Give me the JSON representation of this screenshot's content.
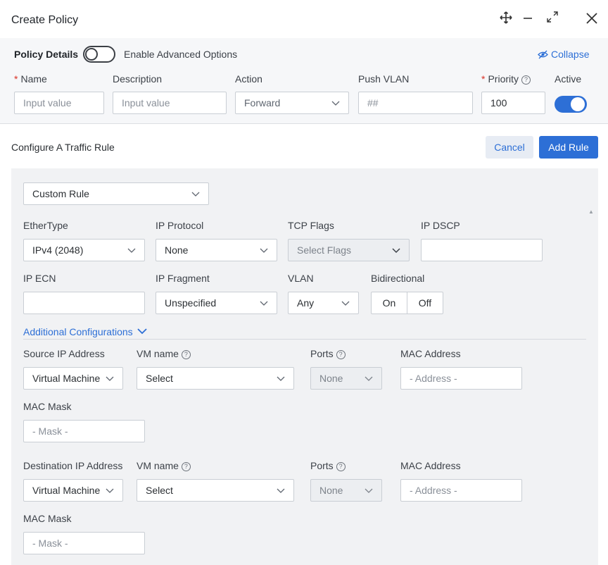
{
  "dialog": {
    "title": "Create Policy"
  },
  "header_icons": {
    "move": "move-icon",
    "minimize": "minimize-icon",
    "expand": "expand-icon",
    "close": "close-icon"
  },
  "policy": {
    "section_label": "Policy Details",
    "advanced_label": "Enable Advanced Options",
    "advanced_on": false,
    "collapse_label": "Collapse",
    "name_label": "Name",
    "name_placeholder": "Input value",
    "description_label": "Description",
    "description_placeholder": "Input value",
    "action_label": "Action",
    "action_value": "Forward",
    "push_vlan_label": "Push VLAN",
    "push_vlan_placeholder": "##",
    "priority_label": "Priority",
    "priority_value": "100",
    "active_label": "Active",
    "active_on": true
  },
  "rule": {
    "title": "Configure A Traffic Rule",
    "cancel_label": "Cancel",
    "add_label": "Add Rule",
    "rule_type": "Custom Rule",
    "ethertype_label": "EtherType",
    "ethertype_value": "IPv4 (2048)",
    "ip_protocol_label": "IP Protocol",
    "ip_protocol_value": "None",
    "tcp_flags_label": "TCP Flags",
    "tcp_flags_value": "Select Flags",
    "ip_dscp_label": "IP DSCP",
    "ip_ecn_label": "IP ECN",
    "ip_fragment_label": "IP Fragment",
    "ip_fragment_value": "Unspecified",
    "vlan_label": "VLAN",
    "vlan_value": "Any",
    "bidirectional_label": "Bidirectional",
    "bidirectional_on": "On",
    "bidirectional_off": "Off",
    "additional_label": "Additional Configurations",
    "source": {
      "ip_label": "Source IP Address",
      "ip_value": "Virtual Machine",
      "vm_label": "VM name",
      "vm_value": "Select",
      "ports_label": "Ports",
      "ports_value": "None",
      "mac_label": "MAC Address",
      "mac_placeholder": "- Address -",
      "mask_label": "MAC Mask",
      "mask_placeholder": "- Mask -"
    },
    "destination": {
      "ip_label": "Destination IP Address",
      "ip_value": "Virtual Machine",
      "vm_label": "VM name",
      "vm_value": "Select",
      "ports_label": "Ports",
      "ports_value": "None",
      "mac_label": "MAC Address",
      "mac_placeholder": "- Address -",
      "mask_label": "MAC Mask",
      "mask_placeholder": "- Mask -"
    }
  },
  "colors": {
    "accent": "#2d6fd6",
    "required": "#d93025",
    "panel": "#f1f2f4"
  }
}
